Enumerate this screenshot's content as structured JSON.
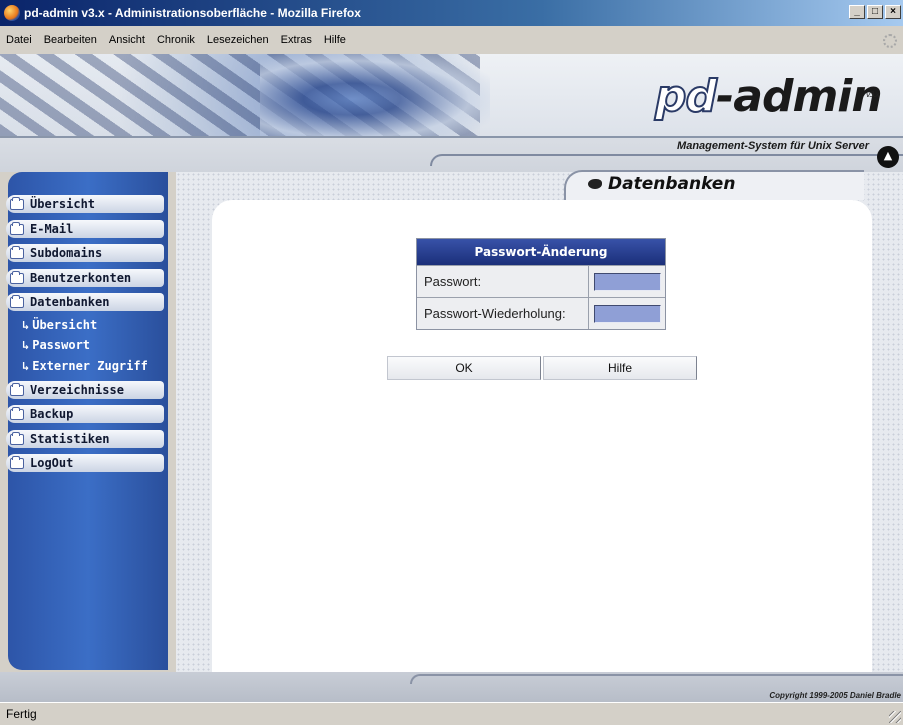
{
  "window": {
    "title": "pd-admin v3.x - Administrationsoberfläche - Mozilla Firefox",
    "controls": [
      "_",
      "□",
      "×"
    ]
  },
  "menubar": {
    "items": [
      "Datei",
      "Bearbeiten",
      "Ansicht",
      "Chronik",
      "Lesezeichen",
      "Extras",
      "Hilfe"
    ]
  },
  "header": {
    "logo_pd": "pd",
    "logo_admin": "-admin",
    "logo_version": "v3.x",
    "tagline": "Management-System für Unix Server"
  },
  "sidebar": {
    "items": [
      {
        "label": "Übersicht"
      },
      {
        "label": "E-Mail"
      },
      {
        "label": "Subdomains"
      },
      {
        "label": "Benutzerkonten"
      },
      {
        "label": "Datenbanken"
      },
      {
        "label": "Verzeichnisse"
      },
      {
        "label": "Backup"
      },
      {
        "label": "Statistiken"
      },
      {
        "label": "LogOut"
      }
    ],
    "subitems": [
      {
        "label": "Übersicht"
      },
      {
        "label": "Passwort"
      },
      {
        "label": "Externer Zugriff"
      }
    ]
  },
  "page": {
    "title": "Datenbanken"
  },
  "form": {
    "title": "Passwort-Änderung",
    "password_label": "Passwort:",
    "password_repeat_label": "Passwort-Wiederholung:",
    "ok_label": "OK",
    "help_label": "Hilfe"
  },
  "footer": {
    "copyright": "Copyright 1999-2005 Daniel Bradle"
  },
  "status": {
    "text": "Fertig"
  },
  "colors": {
    "title_bar": "#0a246a",
    "sidebar": "#3b6ec6",
    "form_header": "#1b2f7a",
    "input_fill": "#8f9fd6"
  }
}
